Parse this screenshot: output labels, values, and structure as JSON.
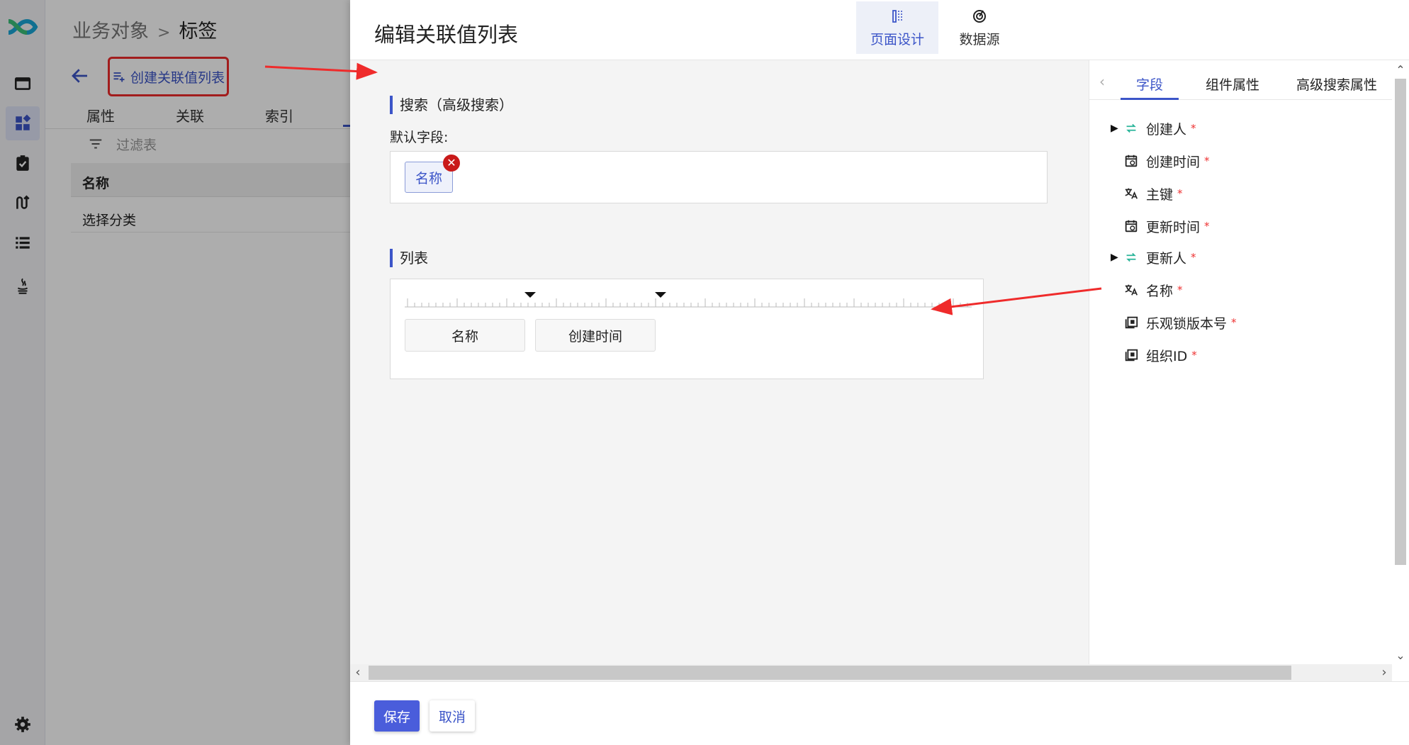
{
  "colors": {
    "accent": "#3c55c8",
    "primary_button": "#4a5ddb",
    "annotation": "#ef2b2b",
    "required": "#e33333",
    "remove": "#c91a1a"
  },
  "rail": {
    "icons": [
      "app-logo-icon",
      "dashboard-icon",
      "widgets-icon",
      "assignment-icon",
      "flow-icon",
      "list-icon",
      "java-icon",
      "settings-icon"
    ]
  },
  "background_page": {
    "breadcrumb": {
      "parent": "业务对象",
      "separator": ">",
      "current": "标签"
    },
    "create_button": "创建关联值列表",
    "tabs": [
      "属性",
      "关联",
      "索引"
    ],
    "filter_placeholder": "过滤表",
    "table": {
      "header": "名称",
      "rows": [
        "选择分类"
      ]
    }
  },
  "drawer": {
    "title": "编辑关联值列表",
    "top_tabs": [
      {
        "label": "页面设计",
        "icon": "page-design-icon",
        "active": true
      },
      {
        "label": "数据源",
        "icon": "datasource-icon",
        "active": false
      }
    ],
    "search_section": {
      "title": "搜索（高级搜索）",
      "default_label": "默认字段:",
      "chips": [
        "名称"
      ]
    },
    "list_section": {
      "title": "列表",
      "columns": [
        "名称",
        "创建时间"
      ]
    },
    "right_panel": {
      "tabs": [
        "字段",
        "组件属性",
        "高级搜索属性"
      ],
      "active_tab": "字段",
      "fields": [
        {
          "label": "创建人",
          "icon": "relation-icon",
          "expandable": true,
          "required": true
        },
        {
          "label": "创建时间",
          "icon": "calendar-icon",
          "expandable": false,
          "required": true
        },
        {
          "label": "主键",
          "icon": "translate-icon",
          "expandable": false,
          "required": true
        },
        {
          "label": "更新时间",
          "icon": "calendar-icon",
          "expandable": false,
          "required": true
        },
        {
          "label": "更新人",
          "icon": "relation-icon",
          "expandable": true,
          "required": true
        },
        {
          "label": "名称",
          "icon": "translate-icon",
          "expandable": false,
          "required": true
        },
        {
          "label": "乐观锁版本号",
          "icon": "number-icon",
          "expandable": false,
          "required": true
        },
        {
          "label": "组织ID",
          "icon": "number-icon",
          "expandable": false,
          "required": true
        }
      ],
      "required_mark": "*"
    },
    "footer": {
      "save": "保存",
      "cancel": "取消"
    }
  }
}
